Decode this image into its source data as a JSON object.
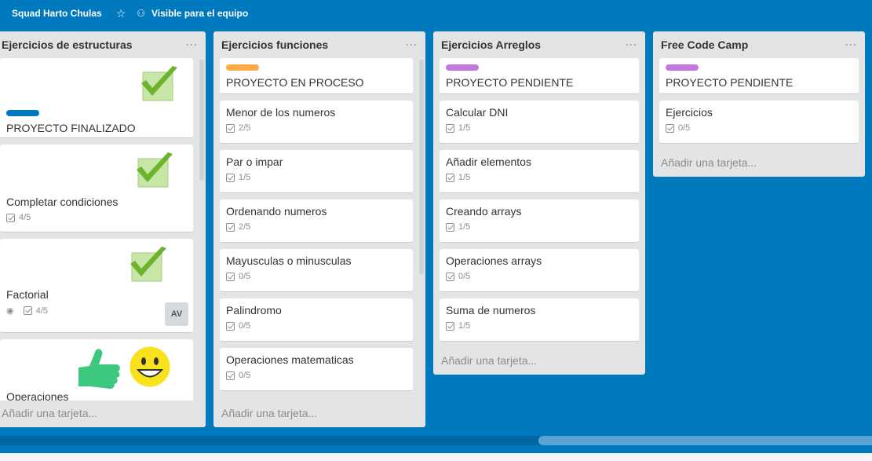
{
  "header": {
    "board_name": "Squad Harto Chulas",
    "visibility": "Visible para el equipo"
  },
  "colors": {
    "background": "#0079bf",
    "label_blue": "#0079bf",
    "label_orange": "#ffab4a",
    "label_purple": "#c377e0"
  },
  "add_card_text": "Añadir una tarjeta...",
  "lists": [
    {
      "title": "Ejercicios de estructuras",
      "cards": [
        {
          "title": "PROYECTO FINALIZADO",
          "label": "blue",
          "sticker": "check-sticker"
        },
        {
          "title": "Completar condiciones",
          "checklist": "4/5",
          "sticker": "check-sticker"
        },
        {
          "title": "Factorial",
          "checklist": "4/5",
          "watch": true,
          "member": "AV",
          "sticker": "check-sticker"
        },
        {
          "title": "Operaciones",
          "sticker": "thumbs-up-and-smiley-sticker"
        }
      ]
    },
    {
      "title": "Ejercicios funciones",
      "cards": [
        {
          "title": "PROYECTO EN PROCESO",
          "label": "orange"
        },
        {
          "title": "Menor de los numeros",
          "checklist": "2/5"
        },
        {
          "title": "Par o impar",
          "checklist": "1/5"
        },
        {
          "title": "Ordenando numeros",
          "checklist": "2/5"
        },
        {
          "title": "Mayusculas o minusculas",
          "checklist": "0/5"
        },
        {
          "title": "Palindromo",
          "checklist": "0/5"
        },
        {
          "title": "Operaciones matematicas",
          "checklist": "0/5"
        }
      ]
    },
    {
      "title": "Ejercicios Arreglos",
      "cards": [
        {
          "title": "PROYECTO PENDIENTE",
          "label": "purple"
        },
        {
          "title": "Calcular DNI",
          "checklist": "1/5"
        },
        {
          "title": "Añadir elementos",
          "checklist": "1/5"
        },
        {
          "title": "Creando arrays",
          "checklist": "1/5"
        },
        {
          "title": "Operaciones arrays",
          "checklist": "0/5"
        },
        {
          "title": "Suma de numeros",
          "checklist": "1/5"
        }
      ]
    },
    {
      "title": "Free Code Camp",
      "cards": [
        {
          "title": "PROYECTO PENDIENTE",
          "label": "purple"
        },
        {
          "title": "Ejercicios",
          "checklist": "0/5"
        }
      ]
    }
  ]
}
